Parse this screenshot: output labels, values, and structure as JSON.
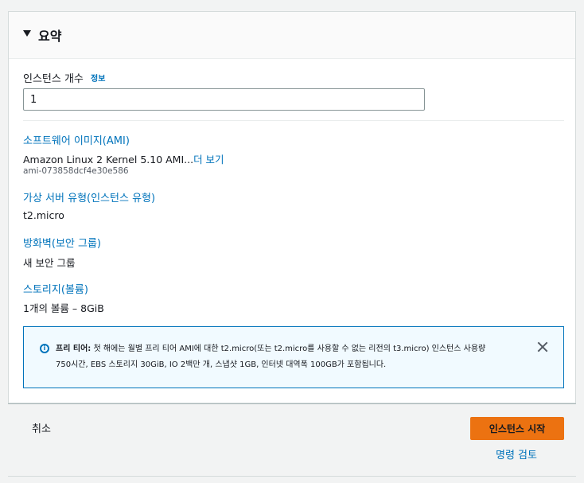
{
  "summary": {
    "title": "요약",
    "instance_count_label": "인스턴스 개수",
    "info_link": "정보",
    "instance_count_value": "1"
  },
  "sections": {
    "ami": {
      "title": "소프트웨어 이미지(AMI)",
      "value_prefix": "Amazon Linux 2 Kernel 5.10 AMI...",
      "more_link": "더 보기",
      "ami_id": "ami-073858dcf4e30e586"
    },
    "instance_type": {
      "title": "가상 서버 유형(인스턴스 유형)",
      "value": "t2.micro"
    },
    "firewall": {
      "title": "방화벽(보안 그룹)",
      "value": "새 보안 그룹"
    },
    "storage": {
      "title": "스토리지(볼륨)",
      "value": "1개의 볼륨 – 8GiB"
    }
  },
  "alert": {
    "icon": "info-icon",
    "bold_label": "프리 티어:",
    "line1": " 첫 해에는 월별 프리 티어 AMI에 대한 t2.micro(또는 t2.micro를 사용할 수 없는 리전의 t3.micro) 인스턴스 사용량",
    "line2": "750시간, EBS 스토리지 30GiB, IO 2백만 개, 스냅샷 1GB, 인터넷 대역폭 100GB가 포함됩니다.",
    "close_icon": "close-icon"
  },
  "footer": {
    "cancel_label": "취소",
    "launch_label": "인스턴스 시작",
    "review_label": "명령 검토"
  },
  "colors": {
    "link": "#0073bb",
    "primary_button": "#ec7211",
    "alert_border": "#0073bb",
    "alert_bg": "#f1faff"
  }
}
